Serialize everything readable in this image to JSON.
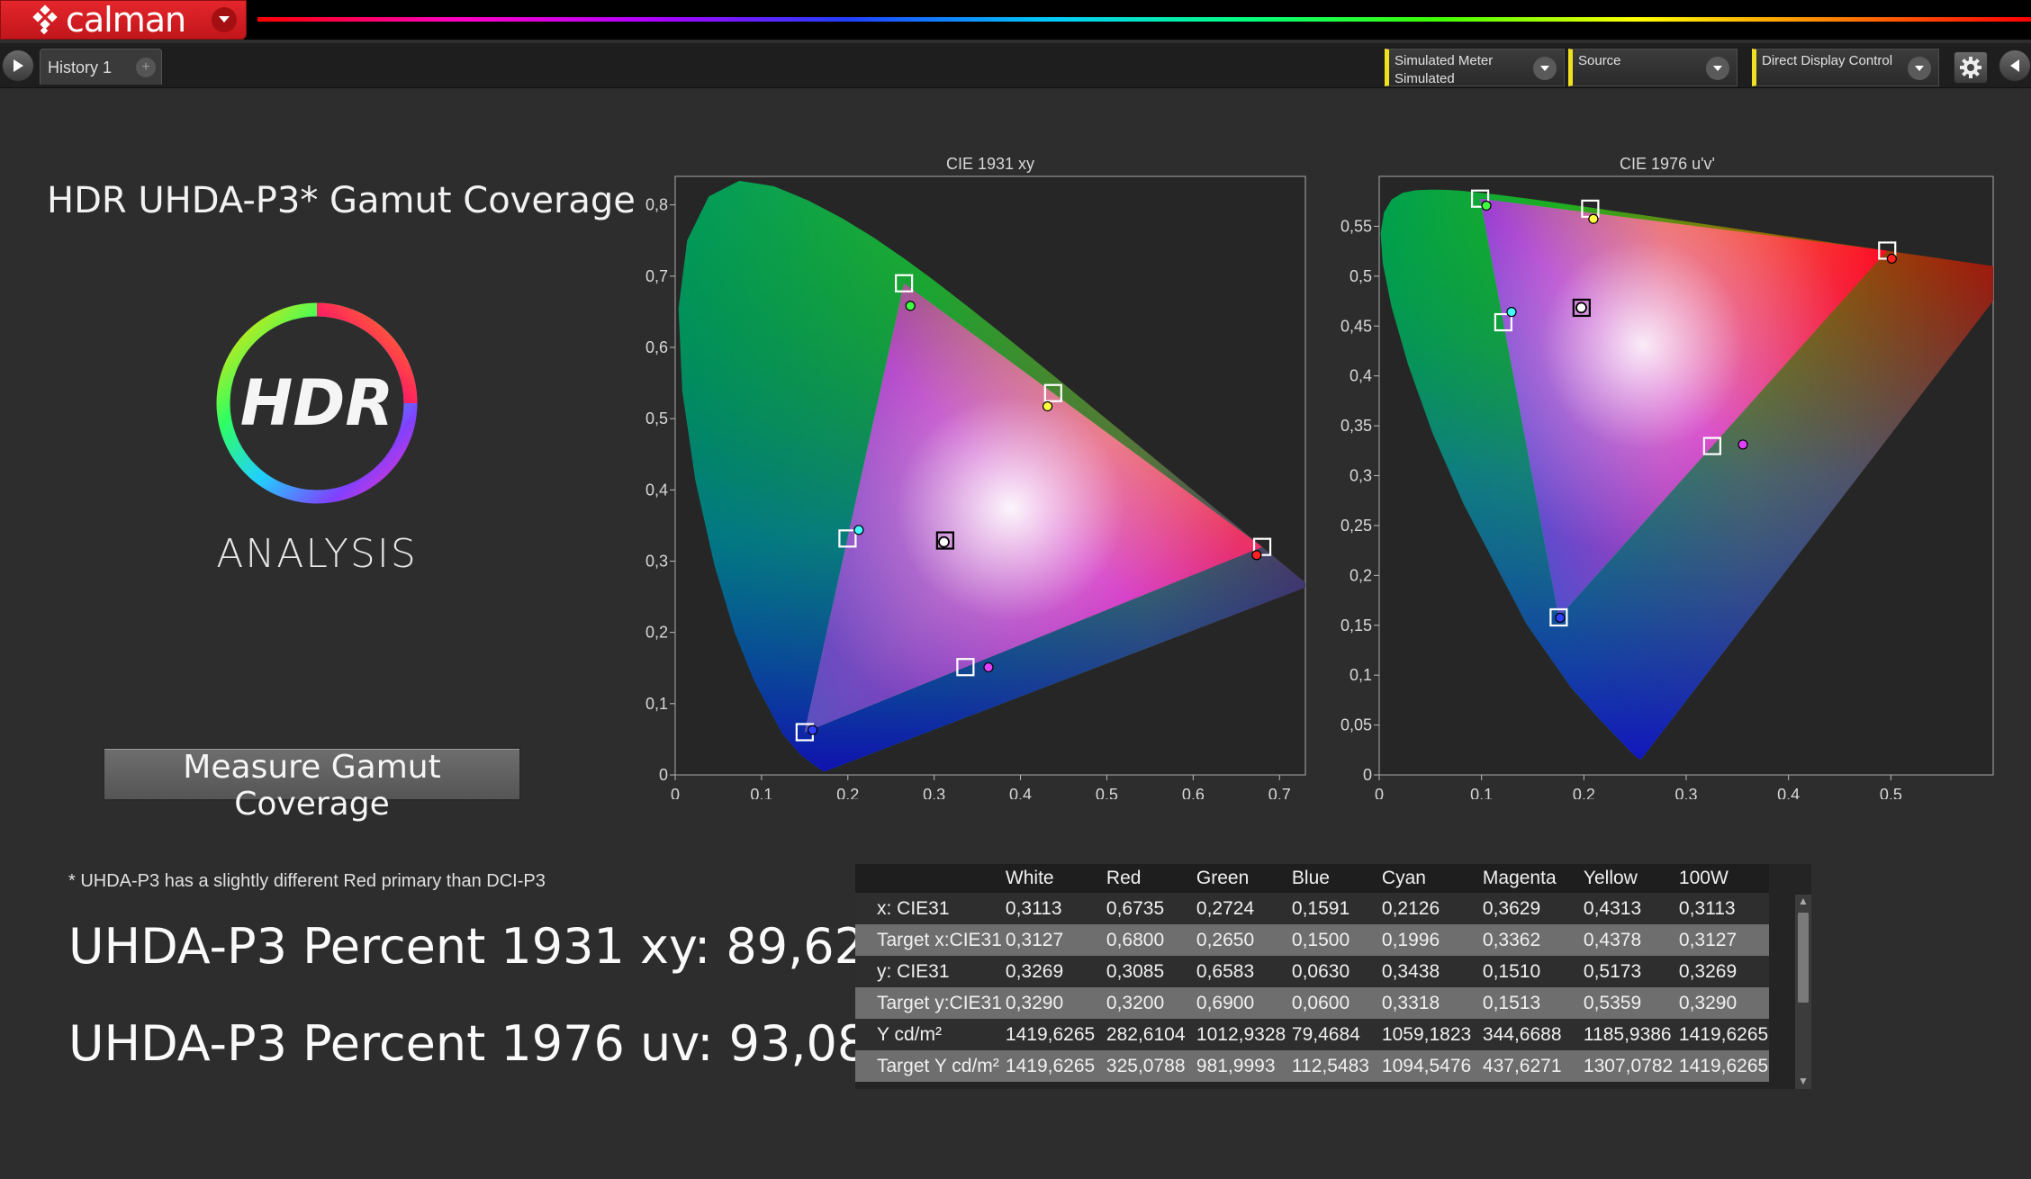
{
  "app": {
    "logo_text": "calman",
    "history_tab": "History 1",
    "add_tab": "+"
  },
  "toolbar": {
    "meter_label": "Simulated Meter",
    "meter_value": "Simulated",
    "source_label": "Source",
    "display_label": "Direct Display Control",
    "accent": "#f0e020"
  },
  "main": {
    "title": "HDR UHDA-P3* Gamut Coverage",
    "logo_word": "HDR",
    "logo_sub": "ANALYSIS",
    "measure_button": "Measure Gamut Coverage",
    "footnote": "* UHDA-P3 has a slightly different Red primary than DCI-P3",
    "pct_1931": "UHDA-P3 Percent 1931 xy: 89,62%",
    "pct_1976": "UHDA-P3 Percent 1976 uv: 93,08%"
  },
  "chart_data": [
    {
      "type": "scatter",
      "title": "CIE 1931 xy",
      "xlim": [
        0,
        0.73
      ],
      "ylim": [
        0,
        0.84
      ],
      "xticks": [
        "0",
        "0,1",
        "0,2",
        "0,3",
        "0,4",
        "0,5",
        "0,6",
        "0,7"
      ],
      "yticks": [
        "0",
        "0,1",
        "0,2",
        "0,3",
        "0,4",
        "0,5",
        "0,6",
        "0,7",
        "0,8"
      ],
      "series": [
        {
          "name": "Target",
          "points": [
            {
              "label": "Red",
              "x": 0.68,
              "y": 0.32,
              "color": "#ffffff"
            },
            {
              "label": "Green",
              "x": 0.265,
              "y": 0.69,
              "color": "#ffffff"
            },
            {
              "label": "Blue",
              "x": 0.15,
              "y": 0.06,
              "color": "#ffffff"
            },
            {
              "label": "Cyan",
              "x": 0.1996,
              "y": 0.3318,
              "color": "#ffffff"
            },
            {
              "label": "Magenta",
              "x": 0.3362,
              "y": 0.1513,
              "color": "#ffffff"
            },
            {
              "label": "Yellow",
              "x": 0.4378,
              "y": 0.5359,
              "color": "#ffffff"
            },
            {
              "label": "White",
              "x": 0.3127,
              "y": 0.329,
              "color": "#000000"
            }
          ]
        },
        {
          "name": "Measured",
          "points": [
            {
              "label": "Red",
              "x": 0.6735,
              "y": 0.3085,
              "color": "#ff2020"
            },
            {
              "label": "Green",
              "x": 0.2724,
              "y": 0.6583,
              "color": "#40ff40"
            },
            {
              "label": "Blue",
              "x": 0.1591,
              "y": 0.063,
              "color": "#3040ff"
            },
            {
              "label": "Cyan",
              "x": 0.2126,
              "y": 0.3438,
              "color": "#40ffff"
            },
            {
              "label": "Magenta",
              "x": 0.3629,
              "y": 0.151,
              "color": "#e040ff"
            },
            {
              "label": "Yellow",
              "x": 0.4313,
              "y": 0.5173,
              "color": "#ffff40"
            },
            {
              "label": "White",
              "x": 0.3113,
              "y": 0.3269,
              "color": "#ffffff"
            }
          ]
        }
      ]
    },
    {
      "type": "scatter",
      "title": "CIE 1976 u'v'",
      "xlim": [
        0,
        0.6
      ],
      "ylim": [
        0,
        0.6
      ],
      "xticks": [
        "0",
        "0,1",
        "0,2",
        "0,3",
        "0,4",
        "0,5"
      ],
      "yticks": [
        "0",
        "0,05",
        "0,1",
        "0,15",
        "0,2",
        "0,25",
        "0,3",
        "0,35",
        "0,4",
        "0,45",
        "0,5",
        "0,55"
      ],
      "series": [
        {
          "name": "Target",
          "points": [
            {
              "label": "Red",
              "x": 0.4964,
              "y": 0.5256,
              "color": "#ffffff"
            },
            {
              "label": "Green",
              "x": 0.0986,
              "y": 0.5777,
              "color": "#ffffff"
            },
            {
              "label": "Blue",
              "x": 0.1754,
              "y": 0.1579,
              "color": "#ffffff"
            },
            {
              "label": "Cyan",
              "x": 0.1213,
              "y": 0.4538,
              "color": "#ffffff"
            },
            {
              "label": "Magenta",
              "x": 0.3254,
              "y": 0.3297,
              "color": "#ffffff"
            },
            {
              "label": "Yellow",
              "x": 0.2062,
              "y": 0.5676,
              "color": "#ffffff"
            },
            {
              "label": "White",
              "x": 0.1978,
              "y": 0.4683,
              "color": "#000000"
            }
          ]
        },
        {
          "name": "Measured",
          "points": [
            {
              "label": "Red",
              "x": 0.5009,
              "y": 0.5175,
              "color": "#ff2020"
            },
            {
              "label": "Green",
              "x": 0.1047,
              "y": 0.5707,
              "color": "#40ff40"
            },
            {
              "label": "Blue",
              "x": 0.1767,
              "y": 0.1575,
              "color": "#3040ff"
            },
            {
              "label": "Cyan",
              "x": 0.1293,
              "y": 0.4641,
              "color": "#40ffff"
            },
            {
              "label": "Magenta",
              "x": 0.3554,
              "y": 0.3312,
              "color": "#e040ff"
            },
            {
              "label": "Yellow",
              "x": 0.2093,
              "y": 0.5574,
              "color": "#ffff40"
            },
            {
              "label": "White",
              "x": 0.1975,
              "y": 0.4684,
              "color": "#ffffff"
            }
          ]
        }
      ]
    }
  ],
  "table": {
    "columns": [
      "",
      "White",
      "Red",
      "Green",
      "Blue",
      "Cyan",
      "Magenta",
      "Yellow",
      "100W"
    ],
    "rows": [
      [
        "x: CIE31",
        "0,3113",
        "0,6735",
        "0,2724",
        "0,1591",
        "0,2126",
        "0,3629",
        "0,4313",
        "0,3113"
      ],
      [
        "Target x:CIE31",
        "0,3127",
        "0,6800",
        "0,2650",
        "0,1500",
        "0,1996",
        "0,3362",
        "0,4378",
        "0,3127"
      ],
      [
        "y: CIE31",
        "0,3269",
        "0,3085",
        "0,6583",
        "0,0630",
        "0,3438",
        "0,1510",
        "0,5173",
        "0,3269"
      ],
      [
        "Target y:CIE31",
        "0,3290",
        "0,3200",
        "0,6900",
        "0,0600",
        "0,3318",
        "0,1513",
        "0,5359",
        "0,3290"
      ],
      [
        "Y cd/m²",
        "1419,6265",
        "282,6104",
        "1012,9328",
        "79,4684",
        "1059,1823",
        "344,6688",
        "1185,9386",
        "1419,6265"
      ],
      [
        "Target Y cd/m²",
        "1419,6265",
        "325,0788",
        "981,9993",
        "112,5483",
        "1094,5476",
        "437,6271",
        "1307,0782",
        "1419,6265"
      ]
    ]
  }
}
